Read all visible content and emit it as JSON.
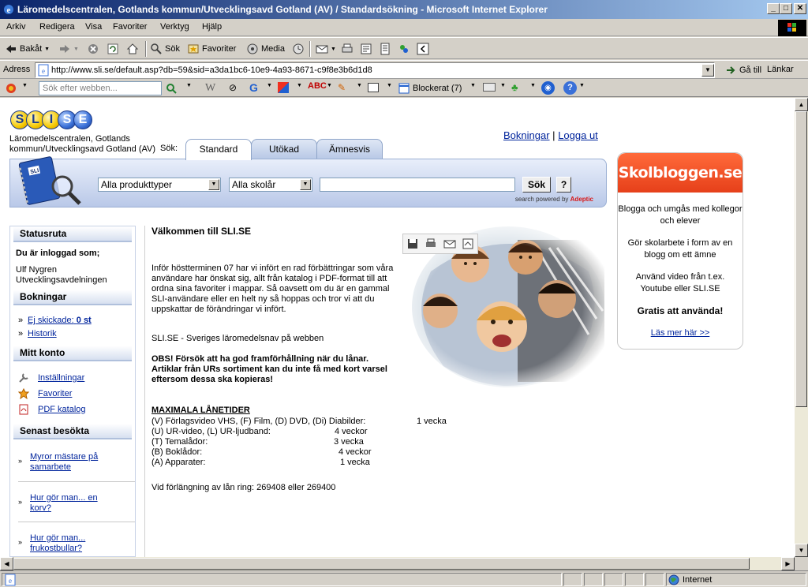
{
  "window": {
    "title": "Läromedelscentralen, Gotlands kommun/Utvecklingsavd Gotland (AV) / Standardsökning - Microsoft Internet Explorer",
    "minimize": "_",
    "maximize": "□",
    "close": "✕"
  },
  "menu": [
    "Arkiv",
    "Redigera",
    "Visa",
    "Favoriter",
    "Verktyg",
    "Hjälp"
  ],
  "toolbar": {
    "back": "Bakåt",
    "search": "Sök",
    "favorites": "Favoriter",
    "media": "Media"
  },
  "address": {
    "label": "Adress",
    "url": "http://www.sli.se/default.asp?db=59&sid=a3da1bc6-10e9-4a93-8671-c9f8e3b6d1d8",
    "go": "Gå till",
    "links": "Länkar"
  },
  "searchbar": {
    "placeholder": "Sök efter webben...",
    "blocked": "Blockerat (7)"
  },
  "site": {
    "logo_letters": [
      "S",
      "L",
      "I",
      "S",
      "E"
    ],
    "org_name": "Läromedelscentralen, Gotlands kommun/Utvecklingsavd Gotland (AV)",
    "search_label": "Sök:",
    "tabs": [
      "Standard",
      "Utökad",
      "Ämnesvis"
    ],
    "top_links": {
      "bookings": "Bokningar",
      "sep": "|",
      "logout": "Logga ut"
    },
    "search": {
      "product_type": "Alla produkttyper",
      "school": "Alla skolår",
      "query": "",
      "button": "Sök",
      "help": "?",
      "powered_prefix": "search powered by",
      "powered_brand": "Adeptic"
    }
  },
  "sidebar": {
    "status_head": "Statusruta",
    "logged_in_label": "Du är inloggad som;",
    "user": "Ulf Nygren Utvecklingsavdelningen",
    "bookings_head": "Bokningar",
    "not_sent": "Ej skickade:",
    "not_sent_count": "0 st",
    "history": "Historik",
    "account_head": "Mitt konto",
    "settings": "Inställningar",
    "favorites": "Favoriter",
    "pdf_catalog": "PDF katalog",
    "recent_head": "Senast besökta",
    "recent": [
      "Myror mästare på samarbete",
      "Hur gör man... en korv?",
      "Hur gör man... frukostbullar?"
    ]
  },
  "main": {
    "title": "Välkommen till SLI.SE",
    "intro": "Inför höstterminen 07 har vi infört en rad förbättringar som våra användare har önskat sig, allt från katalog i PDF-format till att ordna sina favoriter i mappar. Så oavsett om du är en gammal SLI-användare eller en helt ny så hoppas och tror vi att du uppskattar de förändringar vi infört.",
    "tagline": "SLI.SE - Sveriges läromedelsnav på webben",
    "notice": "OBS! Försök att ha god framförhållning när du lånar. Artiklar från URs sortiment kan du inte få med kort varsel eftersom dessa ska kopieras!",
    "loan_head": "MAXIMALA LÅNETIDER",
    "loan_rows": [
      {
        "label": "(V) Förlagsvideo VHS, (F) Film, (D) DVD, (Di) Diabilder:",
        "value": "1 vecka"
      },
      {
        "label": "(U) UR-video, (L) UR-ljudband:",
        "value": "4 veckor"
      },
      {
        "label": "(T) Temalådor:",
        "value": "3 vecka"
      },
      {
        "label": "(B) Boklådor:",
        "value": "4 veckor"
      },
      {
        "label": "(A) Apparater:",
        "value": "1 vecka"
      }
    ],
    "extend": "Vid förlängning av lån ring: 269408 eller 269400"
  },
  "ad": {
    "header": "Skolbloggen.se",
    "p1": "Blogga och umgås med kollegor och elever",
    "p2": "Gör skolarbete i form av en blogg om ett ämne",
    "p3": "Använd video från t.ex. Youtube eller SLI.SE",
    "p4": "Gratis att använda!",
    "link": "Läs mer här >>"
  },
  "status": {
    "zone": "Internet"
  },
  "colors": {
    "title_bar": "#0a246a",
    "link": "#00249c",
    "ad_orange": "#e6401a",
    "panel_blue": "#b9c8e8"
  }
}
